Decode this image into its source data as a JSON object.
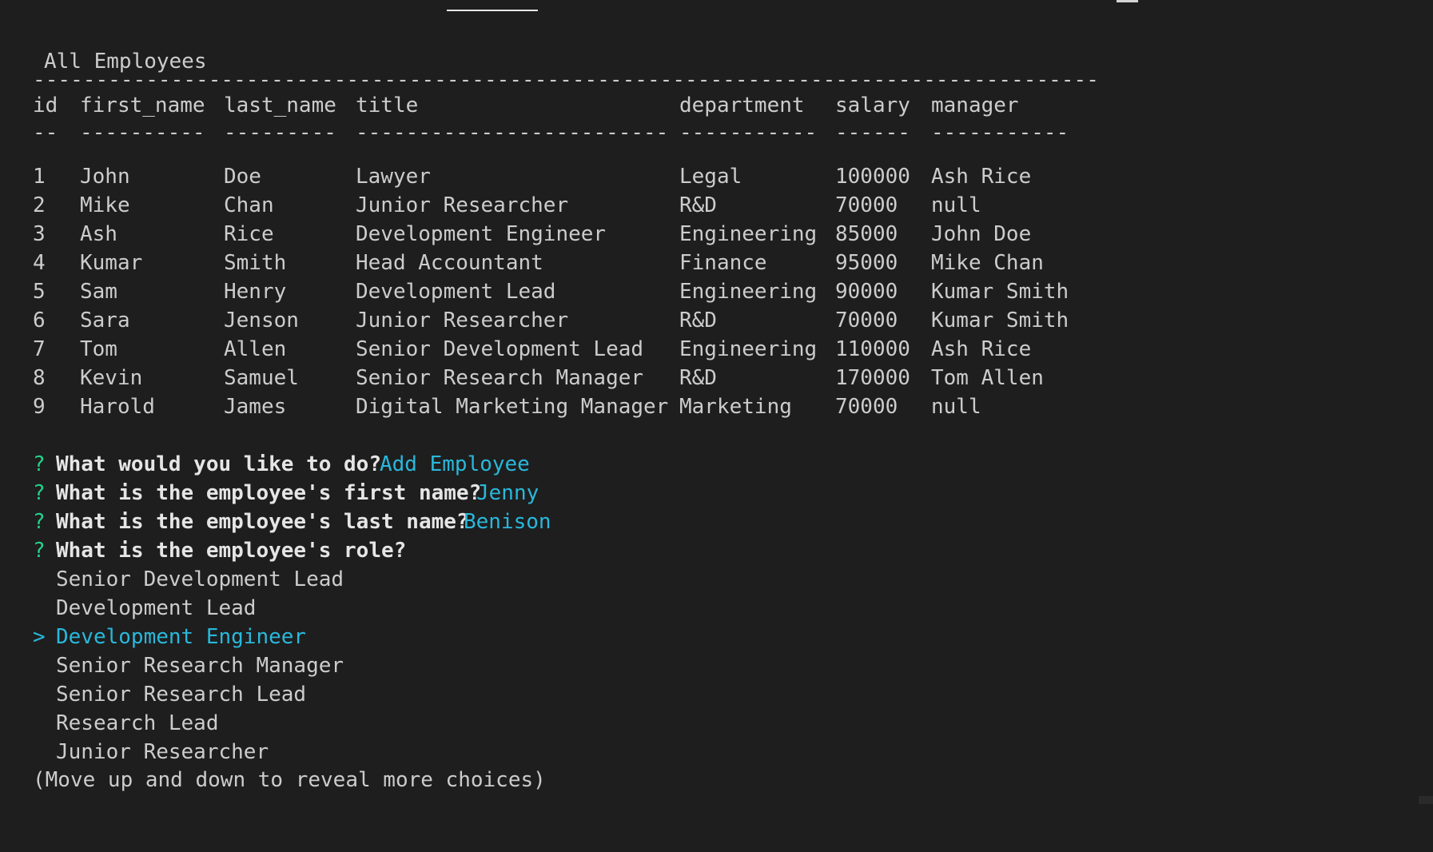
{
  "table": {
    "title": "All Employees",
    "rule": "-------------------------------------------------------------------------------------",
    "columns": [
      "id",
      "first_name",
      "last_name",
      "title",
      "department",
      "salary",
      "manager"
    ],
    "underlines": [
      "--",
      "----------",
      "---------",
      "-------------------------",
      "-----------",
      "------",
      "-----------"
    ],
    "rows": [
      [
        "1",
        "John",
        "Doe",
        "Lawyer",
        "Legal",
        "100000",
        "Ash Rice"
      ],
      [
        "2",
        "Mike",
        "Chan",
        "Junior Researcher",
        "R&D",
        "70000",
        "null"
      ],
      [
        "3",
        "Ash",
        "Rice",
        "Development Engineer",
        "Engineering",
        "85000",
        "John Doe"
      ],
      [
        "4",
        "Kumar",
        "Smith",
        "Head Accountant",
        "Finance",
        "95000",
        "Mike Chan"
      ],
      [
        "5",
        "Sam",
        "Henry",
        "Development Lead",
        "Engineering",
        "90000",
        "Kumar Smith"
      ],
      [
        "6",
        "Sara",
        "Jenson",
        "Junior Researcher",
        "R&D",
        "70000",
        "Kumar Smith"
      ],
      [
        "7",
        "Tom",
        "Allen",
        "Senior Development Lead",
        "Engineering",
        "110000",
        "Ash Rice"
      ],
      [
        "8",
        "Kevin",
        "Samuel",
        "Senior Research Manager",
        "R&D",
        "170000",
        "Tom Allen"
      ],
      [
        "9",
        "Harold",
        "James",
        "Digital Marketing Manager",
        "Marketing",
        "70000",
        "null"
      ]
    ]
  },
  "prompts": [
    {
      "mark": "?",
      "question": "What would you like to do?",
      "answer": "Add Employee"
    },
    {
      "mark": "?",
      "question": "What is the employee's first name?",
      "answer": "Jenny"
    },
    {
      "mark": "?",
      "question": "What is the employee's last name?",
      "answer": "Benison"
    },
    {
      "mark": "?",
      "question": "What is the employee's role?",
      "answer": ""
    }
  ],
  "choices": {
    "pointer": ">",
    "items": [
      "Senior Development Lead",
      "Development Lead",
      "Development Engineer",
      "Senior Research Manager",
      "Senior Research Lead",
      "Research Lead",
      "Junior Researcher"
    ],
    "selected_index": 2,
    "hint": "(Move up and down to reveal more choices)"
  },
  "colors": {
    "background": "#1e1e1e",
    "text": "#cccccc",
    "prompt_mark": "#23d18b",
    "answer": "#29b8db"
  }
}
